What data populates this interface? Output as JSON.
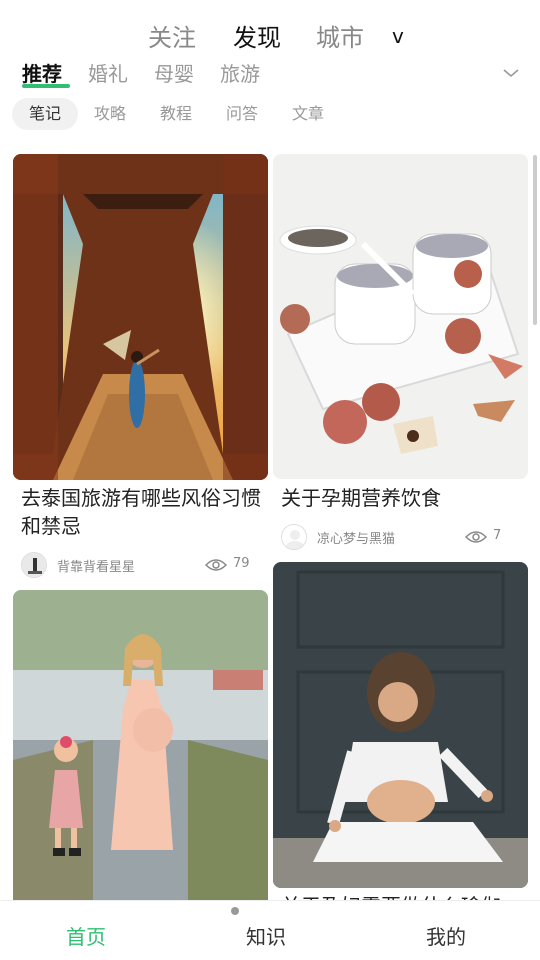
{
  "top_tabs": {
    "follow": "关注",
    "discover": "发现",
    "city": "城市",
    "city_dropdown": "v"
  },
  "category_tabs": [
    "推荐",
    "婚礼",
    "母婴",
    "旅游"
  ],
  "sub_tabs": [
    "笔记",
    "攻略",
    "教程",
    "问答",
    "文章"
  ],
  "cards": [
    {
      "title": "去泰国旅游有哪些风俗习惯和禁忌",
      "author": "背靠背看星星",
      "views": "79"
    },
    {
      "title": "关于孕期营养饮食",
      "author": "凉心梦与黑猫",
      "views": "7"
    },
    {
      "title": "",
      "author": "",
      "views": ""
    },
    {
      "title": "关于孕妇需要做什么瑜伽",
      "author": "",
      "views": ""
    }
  ],
  "bottom_nav": {
    "home": "首页",
    "knowledge": "知识",
    "mine": "我的"
  },
  "colors": {
    "accent": "#2fbf71"
  }
}
